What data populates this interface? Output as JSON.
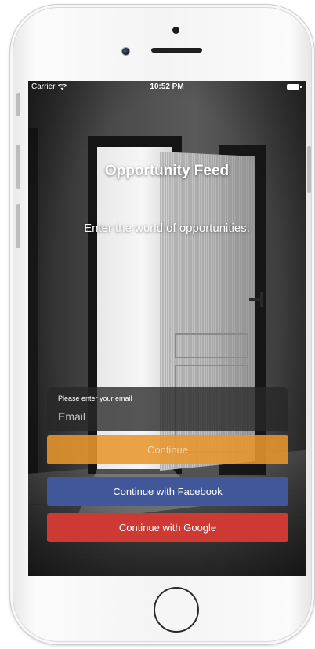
{
  "status_bar": {
    "carrier": "Carrier",
    "time": "10:52 PM",
    "wifi_icon": "wifi-icon",
    "battery_icon": "battery-icon"
  },
  "header": {
    "title": "Opportunity Feed",
    "subtitle": "Enter the world of opportunities."
  },
  "email_form": {
    "label": "Please enter your email",
    "placeholder": "Email",
    "value": ""
  },
  "buttons": {
    "continue_label": "Continue",
    "facebook_label": "Continue with Facebook",
    "google_label": "Continue with Google"
  },
  "colors": {
    "continue_accent": "#E8962E",
    "facebook_blue": "#40579A",
    "google_red": "#CC3A33"
  }
}
